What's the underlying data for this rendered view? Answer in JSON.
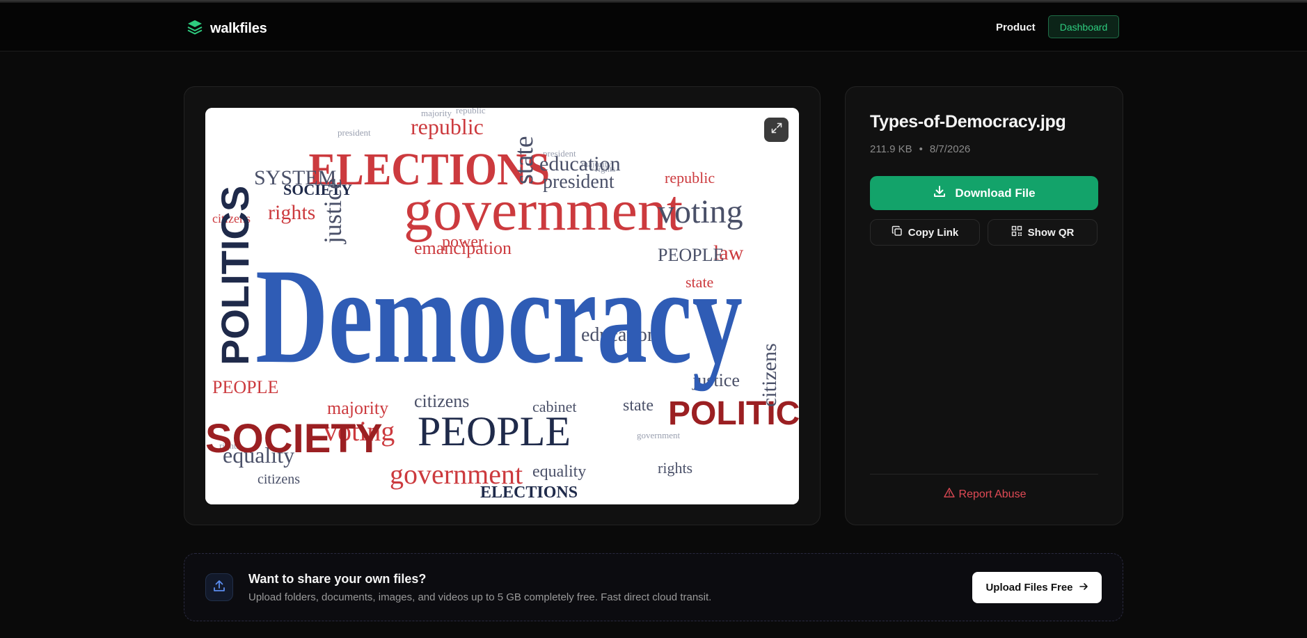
{
  "header": {
    "brand": "walkfiles",
    "nav_product": "Product",
    "nav_dashboard": "Dashboard",
    "accent_color": "#2ecc7f"
  },
  "preview": {
    "image_words": {
      "main": "Democracy",
      "government": "government",
      "elections": "ELECTIONS",
      "politics_left": "POLITICS",
      "politics_right": "POLITICS",
      "people": "PEOPLE",
      "society": "SOCIETY",
      "republic": "republic",
      "state": "state",
      "education": "education",
      "president": "president",
      "voting": "voting",
      "citizens": "citizens",
      "emancipation": "emancipation",
      "justice": "justice",
      "equality": "equality",
      "rights": "rights",
      "law": "law",
      "power": "power",
      "majority": "majority",
      "cabinet": "cabinet",
      "system": "SYSTEM"
    },
    "expand_icon": "expand-icon"
  },
  "file": {
    "name": "Types-of-Democracy.jpg",
    "size": "211.9 KB",
    "separator": "•",
    "date": "8/7/2026",
    "download_label": "Download File",
    "copy_label": "Copy Link",
    "qr_label": "Show QR",
    "report_label": "Report Abuse",
    "download_color": "#13a36a",
    "report_color": "#e04a55"
  },
  "cta": {
    "title": "Want to share your own files?",
    "subtitle": "Upload folders, documents, images, and videos up to 5 GB completely free. Fast direct cloud transit.",
    "button_label": "Upload Files Free"
  }
}
